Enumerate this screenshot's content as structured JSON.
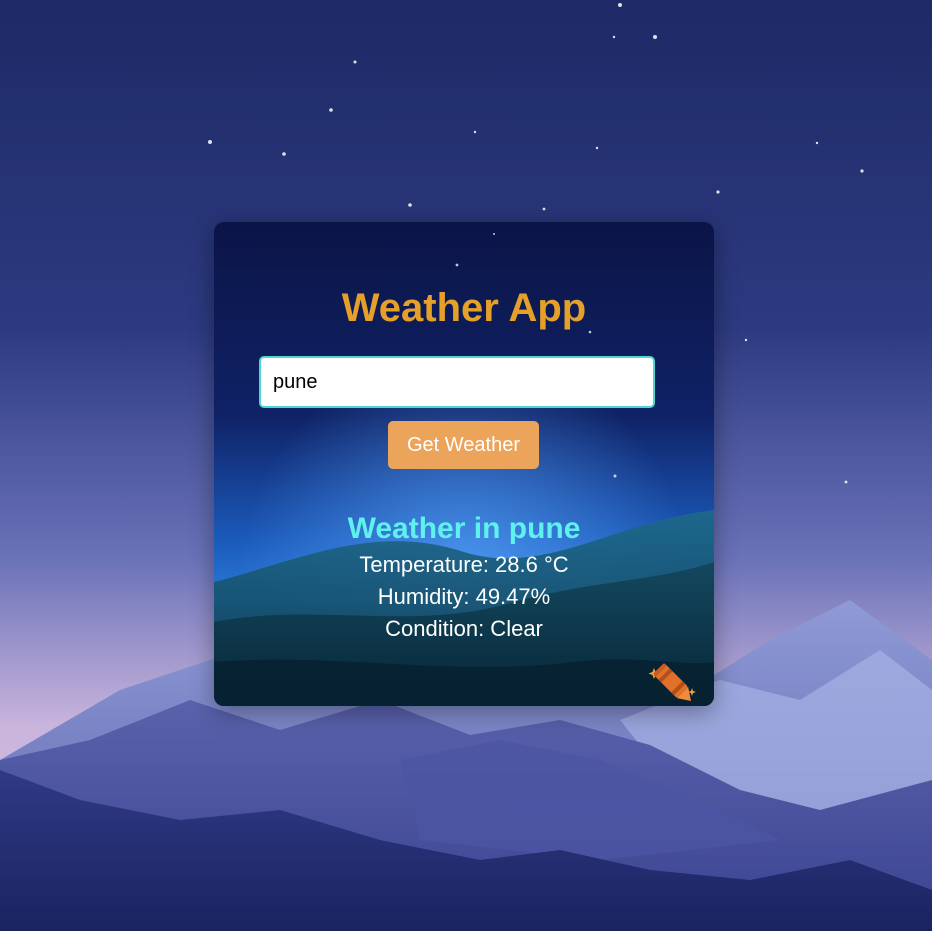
{
  "app": {
    "title": "Weather App"
  },
  "search": {
    "value": "pune",
    "button_label": "Get Weather"
  },
  "result": {
    "heading": "Weather in pune",
    "temperature": "Temperature: 28.6 °C",
    "humidity": "Humidity: 49.47%",
    "condition": "Condition: Clear"
  },
  "icons": {
    "corner": "crayon-icon"
  },
  "colors": {
    "title": "#e5a02a",
    "button": "#eca35a",
    "heading": "#5ef1ee",
    "input_border": "#4fd6d0"
  }
}
